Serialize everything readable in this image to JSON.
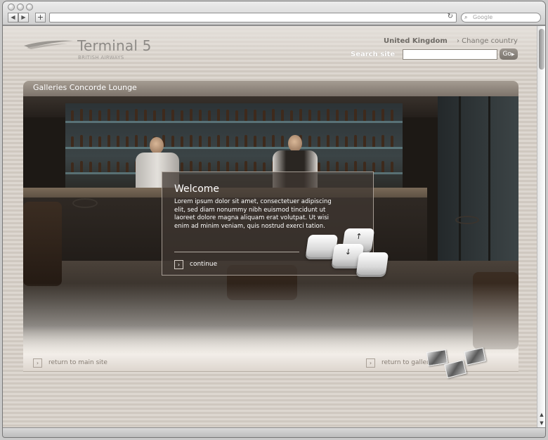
{
  "browser": {
    "back_glyph": "◀",
    "forward_glyph": "▶",
    "add_tab_glyph": "+",
    "reload_glyph": "↻",
    "search_placeholder": "Google",
    "search_icon": "magnifier-icon"
  },
  "header": {
    "logo_title": "Terminal 5",
    "logo_subtitle": "BRITISH AIRWAYS",
    "country": "United Kingdom",
    "change_country": "› Change country",
    "search_label": "Search site",
    "search_value": "",
    "go_label": "Go",
    "go_arrow": "▶"
  },
  "panel": {
    "title": "Galleries Concorde Lounge"
  },
  "dialog": {
    "title": "Welcome",
    "body": "Lorem ipsum dolor sit amet, consectetuer adipiscing elit, sed diam nonummy nibh euismod tincidunt ut laoreet dolore magna aliquam erat volutpat. Ut wisi enim ad minim veniam, quis nostrud exerci tation.",
    "continue_label": "continue",
    "chevron": "›",
    "keys": {
      "up": "↑",
      "down": "↓",
      "left": "",
      "right": ""
    }
  },
  "footer": {
    "return_main": "return to main site",
    "return_galleries": "return to galleries",
    "chevron": "›"
  },
  "colors": {
    "accent": "#8d8a86",
    "panel_header": "#7d746b",
    "stripe_light": "#ddd7d0",
    "stripe_dark": "#cfc8c0"
  }
}
